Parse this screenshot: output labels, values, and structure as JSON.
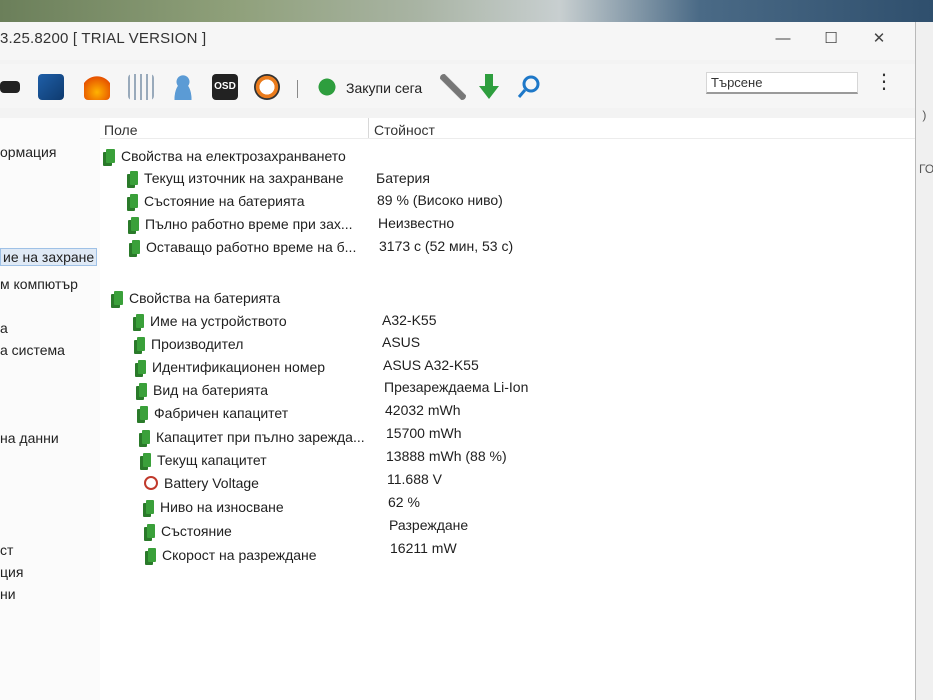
{
  "window": {
    "title": "3.25.8200  [ TRIAL VERSION ]",
    "controls": {
      "minimize": "—",
      "maximize": "☐",
      "close": "✕"
    }
  },
  "toolbar": {
    "buy_label": "Закупи сега",
    "search_placeholder": "Търсене",
    "more": "⋮"
  },
  "sidebar": {
    "items": [
      {
        "label": "ормация"
      },
      {
        "label": "ие на захране",
        "selected": true
      },
      {
        "label": "м компютър"
      },
      {
        "label": "а"
      },
      {
        "label": "а система"
      },
      {
        "label": "на данни"
      },
      {
        "label": "ст"
      },
      {
        "label": "ция"
      },
      {
        "label": "ни"
      }
    ]
  },
  "grid": {
    "columns": {
      "field": "Поле",
      "value": "Стойност"
    },
    "sections": [
      {
        "title": "Свойства на електрозахранването",
        "rows": [
          {
            "field": "Текущ източник на захранване",
            "value": "Батерия"
          },
          {
            "field": "Състояние на батерията",
            "value": "89 % (Високо ниво)"
          },
          {
            "field": "Пълно работно време при зах...",
            "value": "Неизвестно"
          },
          {
            "field": "Оставащо работно време на б...",
            "value": "3173 с (52 мин, 53 с)"
          }
        ]
      },
      {
        "title": "Свойства на батерията",
        "rows": [
          {
            "field": "Име на устройството",
            "value": "A32-K55"
          },
          {
            "field": "Производител",
            "value": "ASUS"
          },
          {
            "field": "Идентификационен номер",
            "value": "ASUS A32-K55"
          },
          {
            "field": "Вид на батерията",
            "value": "Презареждаема Li-Ion"
          },
          {
            "field": "Фабричен капацитет",
            "value": "42032 mWh"
          },
          {
            "field": "Капацитет при пълно зарежда...",
            "value": "15700 mWh"
          },
          {
            "field": "Текущ капацитет",
            "value": "13888 mWh  (88 %)"
          },
          {
            "field": "Battery Voltage",
            "value": "11.688 V"
          },
          {
            "field": "Ниво на износване",
            "value": "62 %"
          },
          {
            "field": "Състояние",
            "value": "Разреждане"
          },
          {
            "field": "Скорост на разреждане",
            "value": "16211 mW"
          }
        ]
      }
    ]
  },
  "side": {
    "marks": [
      " )",
      "ГО"
    ]
  },
  "colors": {
    "accent": "#3aa03a",
    "selection": "#dfe9f5",
    "search_icon": "#1e78c8"
  }
}
